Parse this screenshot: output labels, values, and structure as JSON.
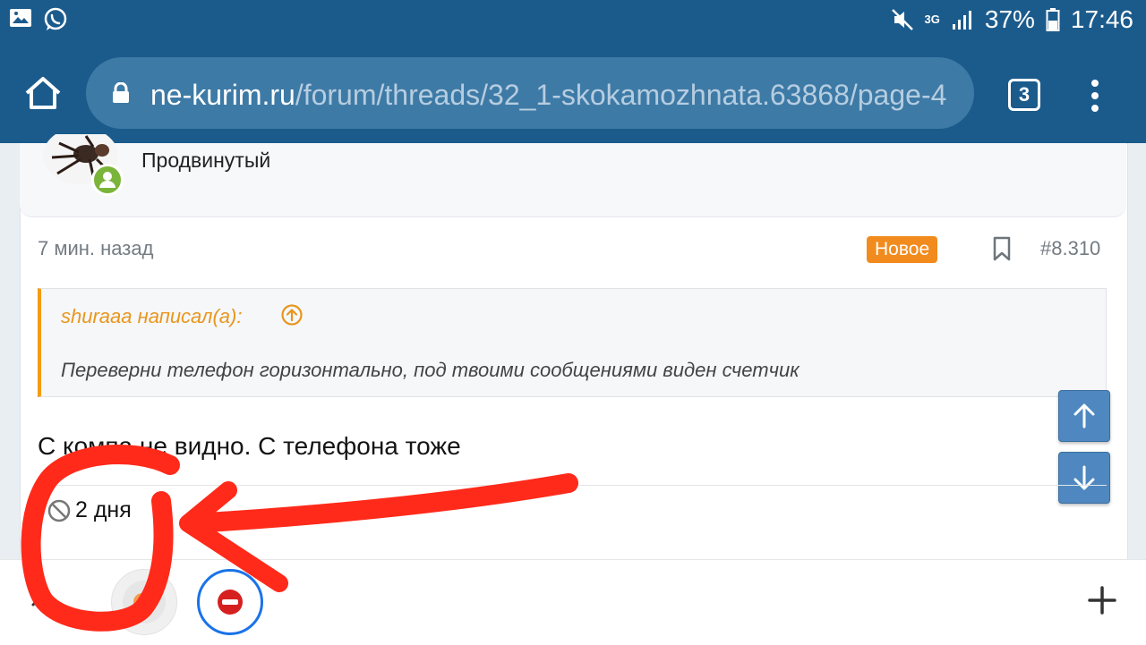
{
  "status_bar": {
    "battery_percent": "37%",
    "time": "17:46",
    "network_type": "3G",
    "icons": [
      "gallery-icon",
      "whatsapp-icon",
      "mute-icon",
      "signal-icon",
      "battery-icon"
    ]
  },
  "browser": {
    "url_host": "ne-kurim.ru",
    "url_path": "/forum/threads/32_1-skokamozhnata.63868/page-4",
    "tab_count": "3",
    "icons": [
      "home-icon",
      "lock-icon",
      "tabs-icon",
      "overflow-menu-icon"
    ]
  },
  "post": {
    "user_title": "Продвинутый",
    "time_ago": "7 мин. назад",
    "new_badge": "Новое",
    "post_number": "#8.310",
    "quote": {
      "author": "shuraaa написал(а):",
      "text": "Переверни телефон горизонтально, под твоими сообщениями виден счетчик"
    },
    "message": "С компа не видно. С телефона тоже",
    "ban_duration": "2 дня"
  },
  "colors": {
    "brand_bar": "#1b5b8c",
    "url_bar": "#3e7aa6",
    "badge_new": "#f28b1e",
    "quote_accent": "#f39c12",
    "scroll_buttons": "#4f88c0",
    "annotation": "#ff2a1a"
  }
}
